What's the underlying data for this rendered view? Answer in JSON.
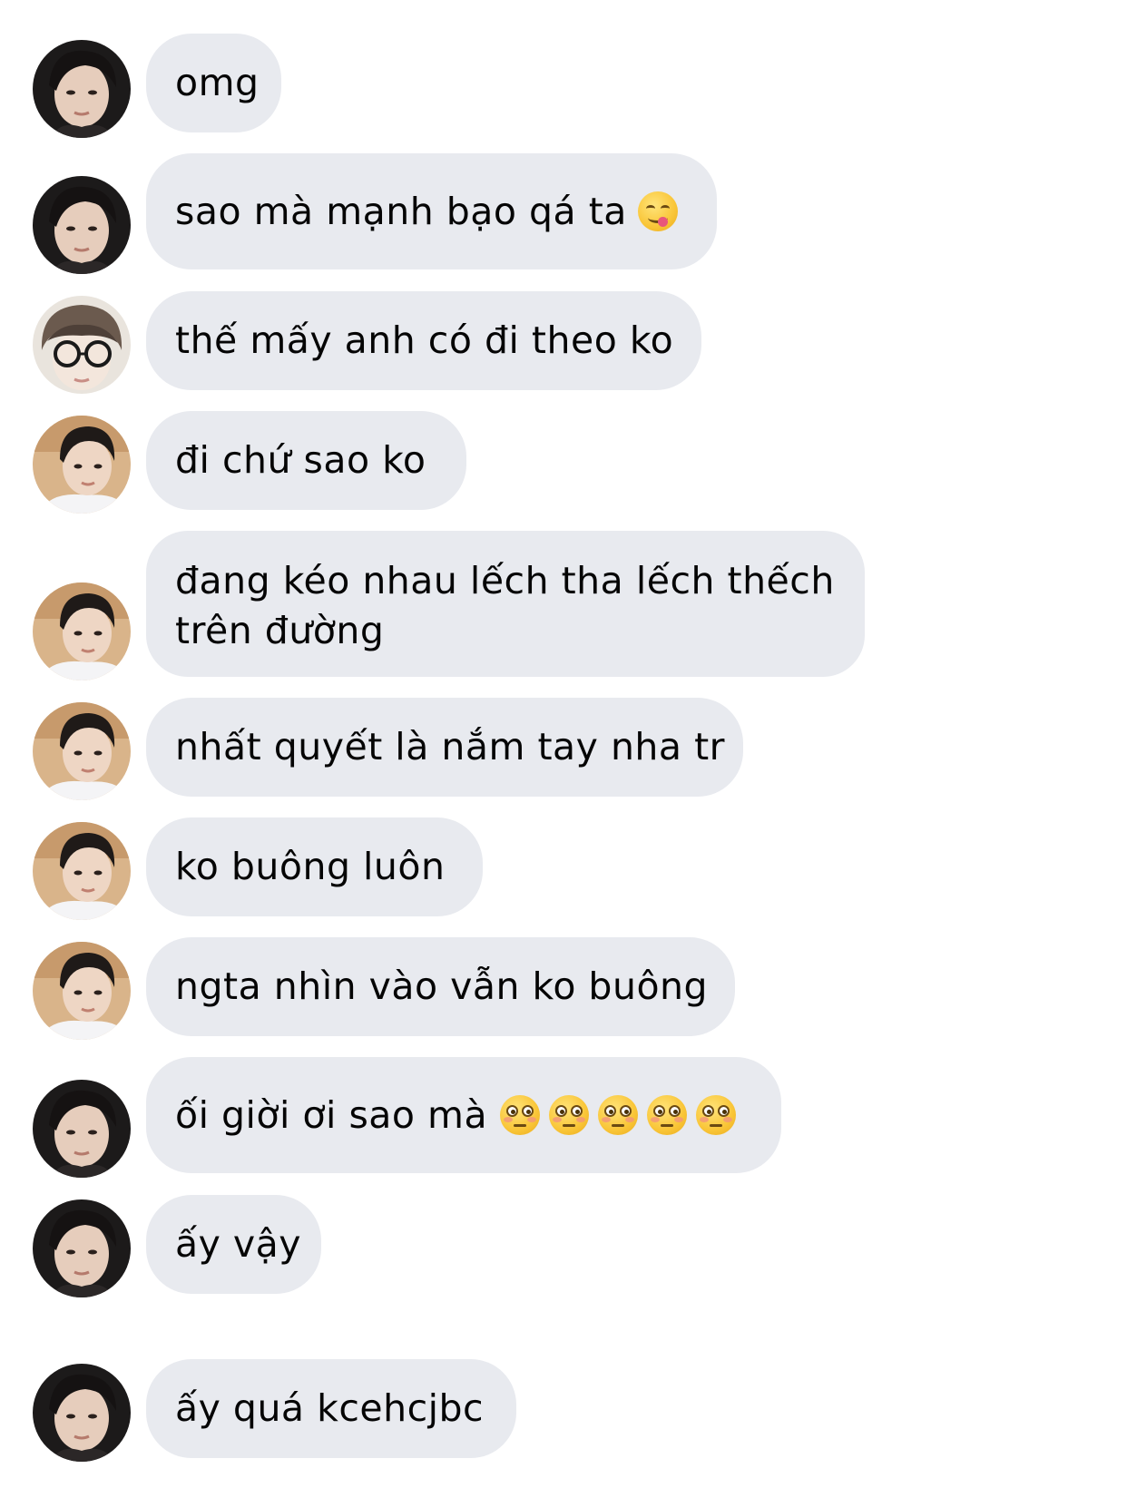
{
  "messages": [
    {
      "sender": "a",
      "text": "omg",
      "emoji": {
        "icon": "face-savoring-food-emoji",
        "count": 0
      }
    },
    {
      "sender": "a",
      "text": "sao mà mạnh bạo qá ta",
      "emoji": {
        "icon": "face-savoring-food-emoji",
        "count": 1
      }
    },
    {
      "sender": "b",
      "text": "thế mấy anh có đi theo ko"
    },
    {
      "sender": "c",
      "text": "đi chứ sao ko"
    },
    {
      "sender": "c",
      "text": "đang kéo nhau lếch tha lếch thếch trên đường"
    },
    {
      "sender": "c",
      "text": "nhất quyết là nắm tay nha tr"
    },
    {
      "sender": "c",
      "text": "ko buông luôn"
    },
    {
      "sender": "c",
      "text": "ngta nhìn vào vẫn ko buông"
    },
    {
      "sender": "a",
      "text": "ối giời ơi sao mà",
      "emoji": {
        "icon": "flushed-face-emoji",
        "count": 5
      }
    },
    {
      "sender": "a",
      "text": "ấy vậy"
    },
    {
      "sender": "a",
      "text": "ấy quá kcehcjbc"
    }
  ],
  "colors": {
    "bubble_bg": "#e8eaef",
    "text": "#050505",
    "page_bg": "#ffffff"
  },
  "avatars": {
    "a": "dark-hair-portrait-avatar",
    "b": "glasses-portrait-avatar",
    "c": "beach-portrait-avatar"
  }
}
